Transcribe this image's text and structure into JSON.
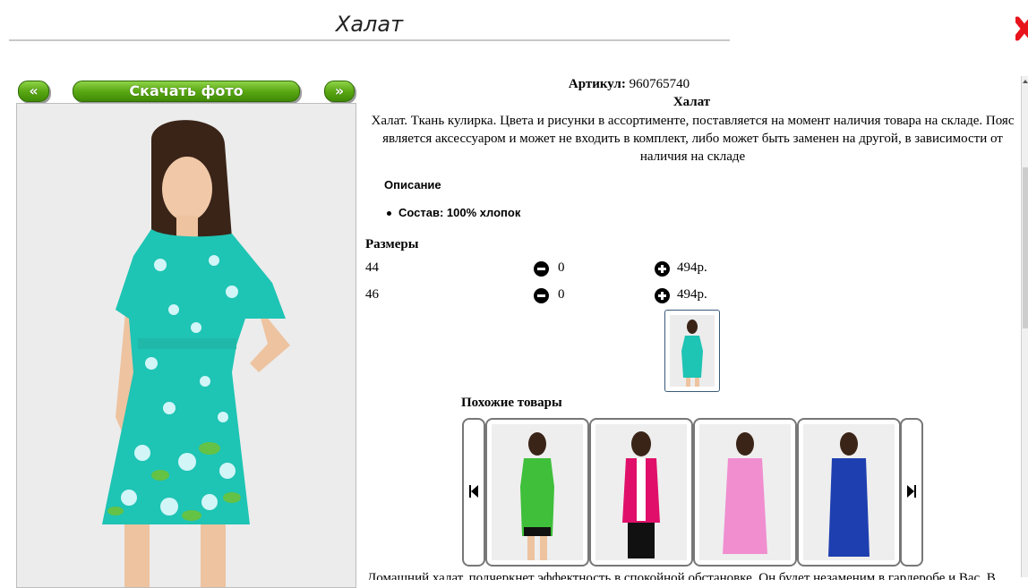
{
  "page": {
    "title": "Халат"
  },
  "toolbar": {
    "prev_label": "«",
    "download_label": "Скачать фото",
    "next_label": "»"
  },
  "product": {
    "article_label": "Артикул:",
    "article_value": "960765740",
    "name": "Халат",
    "description": "Халат. Ткань кулирка. Цвета и рисунки в ассортименте, поставляется на момент наличия товара на складе. Пояс является аксессуаром и может не входить в комплект, либо может быть заменен на другой, в зависимости от наличия на складе",
    "details_heading": "Описание",
    "composition": "Состав: 100% хлопок"
  },
  "sizes": {
    "heading": "Размеры",
    "rows": [
      {
        "size": "44",
        "qty": "0",
        "price": "494р."
      },
      {
        "size": "46",
        "qty": "0",
        "price": "494р."
      }
    ]
  },
  "similar": {
    "heading": "Похожие товары",
    "items": [
      {
        "color": "#3fbf3a",
        "name": "green-tunic"
      },
      {
        "color": "#e0106a",
        "name": "pink-vest"
      },
      {
        "color": "#f08ed0",
        "name": "pink-robe"
      },
      {
        "color": "#1e3fb0",
        "name": "blue-robe"
      }
    ]
  },
  "footer_text": "Домашний халат, подчеркнет эффектность в спокойной обстановке. Он будет незаменим в гардеробе и Вас. В...",
  "colors": {
    "accent_green": "#5aa813",
    "dress_teal": "#1ec4b4",
    "close_red": "#e8141c"
  }
}
